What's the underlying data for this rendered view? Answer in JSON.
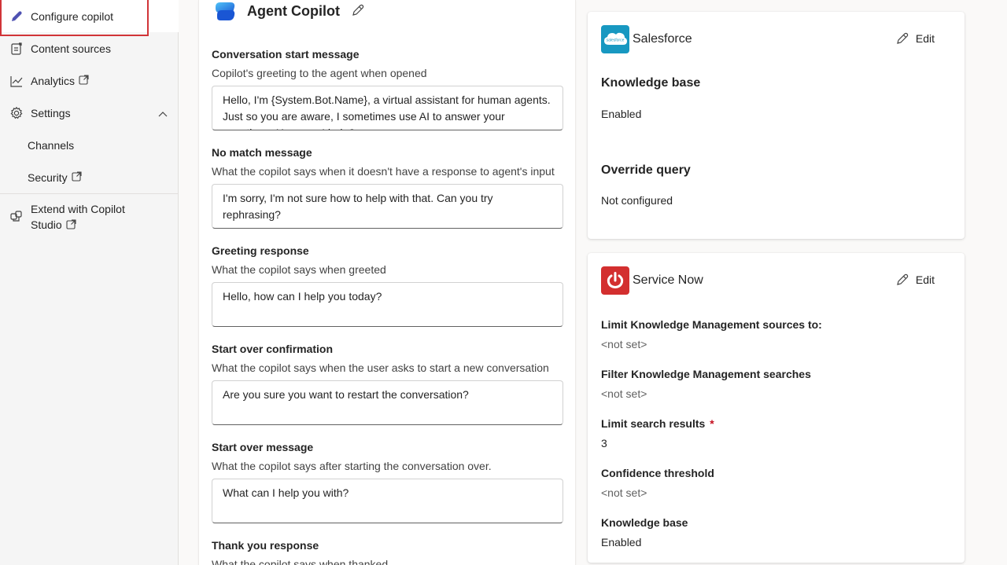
{
  "sidebar": {
    "items": [
      {
        "label": "Configure copilot",
        "icon": "pencil-icon",
        "active": true
      },
      {
        "label": "Content sources",
        "icon": "content-sources-icon"
      },
      {
        "label": "Analytics",
        "icon": "analytics-chart-icon",
        "external": true
      },
      {
        "label": "Settings",
        "icon": "gear-icon",
        "expanded": true
      },
      {
        "label": "Channels"
      },
      {
        "label": "Security",
        "external": true
      },
      {
        "label": "Extend with Copilot",
        "label2": "Studio",
        "icon": "extend-icon",
        "external": true
      }
    ]
  },
  "main": {
    "title": "Agent Copilot",
    "fields": [
      {
        "label": "Conversation start message",
        "description": "Copilot's greeting to the agent when opened",
        "value": "Hello, I'm {System.Bot.Name}, a virtual assistant for human agents. Just so you are aware, I sometimes use AI to answer your questions. How can I help?"
      },
      {
        "label": "No match message",
        "description": "What the copilot says when it doesn't have a response to agent's input",
        "value": "I'm sorry, I'm not sure how to help with that. Can you try rephrasing?"
      },
      {
        "label": "Greeting response",
        "description": "What the copilot says when greeted",
        "value": "Hello, how can I help you today?"
      },
      {
        "label": "Start over confirmation",
        "description": "What the copilot says when the user asks to start a new conversation",
        "value": "Are you sure you want to restart the conversation?"
      },
      {
        "label": "Start over message",
        "description": "What the copilot says after starting the conversation over.",
        "value": "What can I help you with?"
      },
      {
        "label": "Thank you response",
        "description": "What the copilot says when thanked"
      }
    ]
  },
  "cards": {
    "salesforce": {
      "name": "Salesforce",
      "logo_text": "salesforce",
      "edit_label": "Edit",
      "sections": [
        {
          "title": "Knowledge base",
          "value": "Enabled"
        },
        {
          "title": "Override query",
          "value": "Not configured"
        }
      ]
    },
    "servicenow": {
      "name": "Service Now",
      "edit_label": "Edit",
      "fields": [
        {
          "label": "Limit Knowledge Management sources to:",
          "value": "<not set>"
        },
        {
          "label": "Filter Knowledge Management searches",
          "value": "<not set>"
        },
        {
          "label": "Limit search results",
          "required_mark": "*",
          "value": "3"
        },
        {
          "label": "Confidence threshold",
          "value": "<not set>"
        },
        {
          "label": "Knowledge base",
          "value": "Enabled"
        }
      ]
    }
  },
  "colors": {
    "accent": "#4f52b2",
    "highlight_outline": "#d13438",
    "salesforce": "#1798c1",
    "servicenow": "#d32f2f"
  }
}
